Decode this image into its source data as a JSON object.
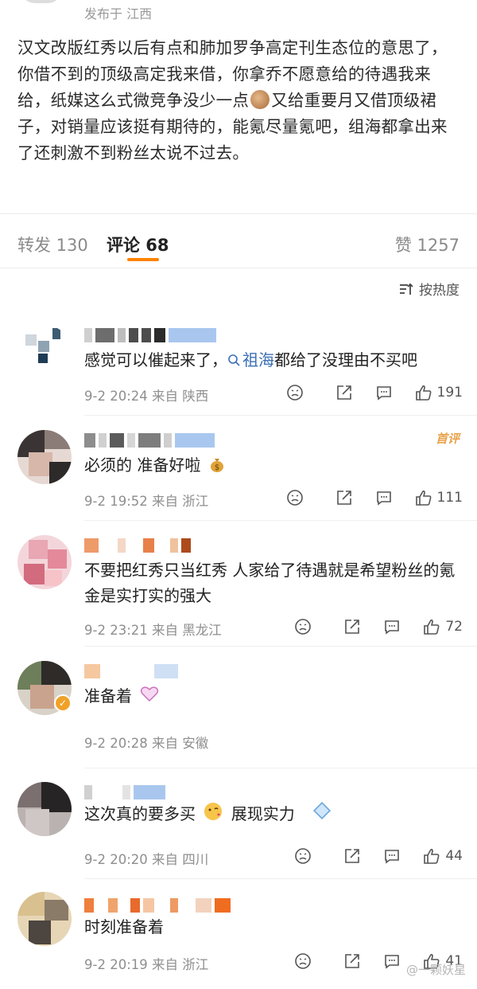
{
  "post": {
    "location_text": "发布于 江西",
    "body": "汉文改版红秀以后有点和肺加罗争高定刊生态位的意思了，你借不到的顶级高定我来借，你拿乔不愿意给的待遇我来给，纸媒这么式微竞争没少一点",
    "body_after_emoji": "又给重要月又借顶级裙子，对销量应该挺有期待的，能氪尽量氪吧，组海都拿出来了还刺激不到粉丝太说不过去。"
  },
  "tabs": {
    "repost": "转发 130",
    "comments": "评论 68",
    "likes": "赞 1257"
  },
  "sort_label": "按热度",
  "comments": [
    {
      "text_before": "感觉可以催起来了，",
      "link": "祖海",
      "text_after": "都给了没理由不买吧",
      "time": "9-2 20:24",
      "source": "来自 陕西",
      "likes": "191"
    },
    {
      "badge": "首评",
      "text": "必须的 准备好啦",
      "time": "9-2 19:52",
      "source": "来自 浙江",
      "likes": "111"
    },
    {
      "text": "不要把红秀只当红秀 人家给了待遇就是希望粉丝的氪金是实打实的强大",
      "time": "9-2 23:21",
      "source": "来自 黑龙江",
      "likes": "72"
    },
    {
      "text": "准备着",
      "time": "9-2 20:28",
      "source": "来自 安徽",
      "likes": ""
    },
    {
      "text_before": "这次真的要多买",
      "text_after": "展现实力",
      "time": "9-2 20:20",
      "source": "来自 四川",
      "likes": "44"
    },
    {
      "text": "时刻准备着",
      "time": "9-2 20:19",
      "source": "来自 浙江",
      "likes": "41"
    }
  ],
  "watermark": "@一颗妖星",
  "colors": {
    "accent": "#ff8200",
    "link": "#3b6fb6",
    "meta": "#8e8e8e"
  }
}
